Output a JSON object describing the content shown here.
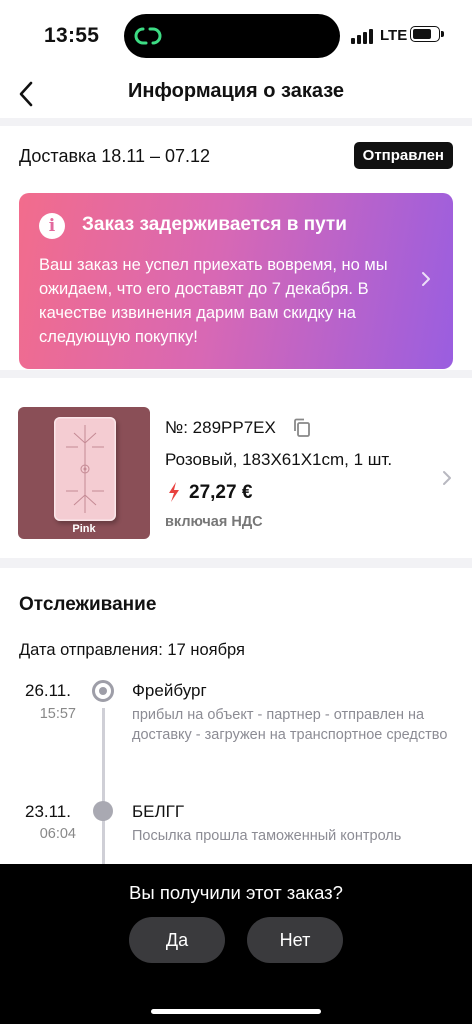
{
  "status_bar": {
    "time": "13:55",
    "network": "LTE",
    "battery_level": 0.8,
    "signal_bars": 4
  },
  "nav": {
    "title": "Информация о заказе",
    "back_icon": "chevron-left-icon"
  },
  "delivery": {
    "text": "Доставка 18.11 – 07.12",
    "status": "Отправлен"
  },
  "promo": {
    "title": "Заказ задерживается в пути",
    "body": "Ваш заказ не успел приехать вовремя, но мы ожидаем, что его доставят до 7 декабря. В качестве извинения дарим вам скидку на следующую покупку!",
    "icon": "info-icon",
    "colors": {
      "start": "#f26c8c",
      "end": "#9a5ee0"
    }
  },
  "product": {
    "order_number": "№: 289PP7EX",
    "variant": "Розовый, 183X61X1cm, 1 шт.",
    "price": "27,27 €",
    "vat": "включая НДС",
    "image_label": "Pink"
  },
  "tracking": {
    "title": "Отслеживание",
    "ship_date": "Дата отправления: 17 ноября",
    "events": [
      {
        "date": "26.11.",
        "time": "15:57",
        "city": "Фрейбург",
        "desc": "прибыл на объект - партнер - отправлен на доставку - загружен на транспортное средство"
      },
      {
        "date": "23.11.",
        "time": "06:04",
        "city": "БЕЛГГ",
        "desc": "Посылка прошла таможенный контроль"
      }
    ]
  },
  "bottom_sheet": {
    "question": "Вы получили этот заказ?",
    "yes": "Да",
    "no": "Нет"
  },
  "colors": {
    "accent_red": "#e8423f",
    "badge_bg": "#111111"
  }
}
